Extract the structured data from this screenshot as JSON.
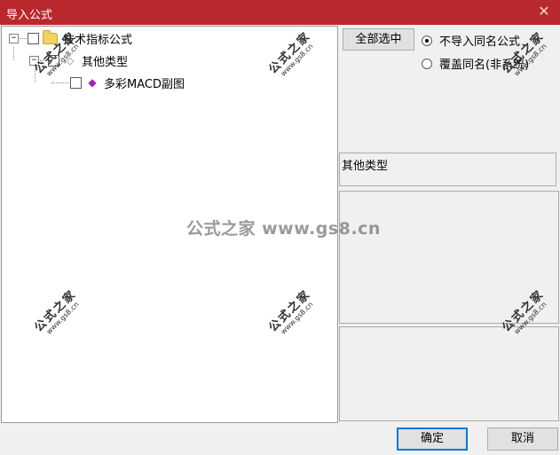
{
  "window": {
    "title": "导入公式",
    "close_glyph": "✕"
  },
  "tree": {
    "root": {
      "expander": "−",
      "label": "技术指标公式"
    },
    "child": {
      "expander": "−",
      "label": "其他类型"
    },
    "leaf": {
      "label": "多彩MACD副图"
    }
  },
  "options": {
    "select_all_label": "全部选中",
    "radio_skip_label": "不导入同名公式",
    "radio_overwrite_label": "覆盖同名(非系统)",
    "selected_option": "radio_skip"
  },
  "category_label": "其他类型",
  "buttons": {
    "ok_label": "确定",
    "cancel_label": "取消"
  },
  "watermark": {
    "center_text": "公式之家 www.gs8.cn",
    "stamp_big": "公式之家",
    "stamp_small": "www.gs8.cn"
  }
}
